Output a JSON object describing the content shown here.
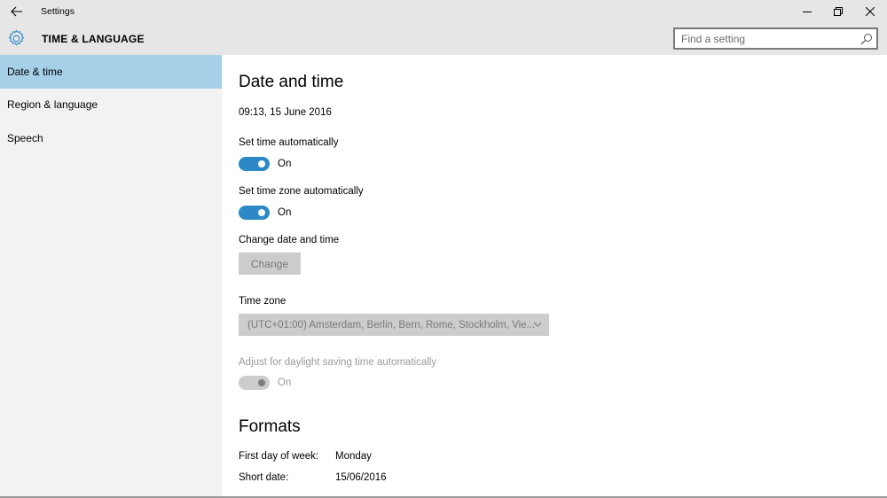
{
  "window": {
    "title": "Settings",
    "minimize_icon": "minimize-icon",
    "restore_icon": "restore-icon",
    "close_icon": "close-icon"
  },
  "header": {
    "section_title": "TIME & LANGUAGE",
    "search_placeholder": "Find a setting"
  },
  "sidebar": {
    "items": [
      {
        "label": "Date & time",
        "active": true
      },
      {
        "label": "Region & language",
        "active": false
      },
      {
        "label": "Speech",
        "active": false
      }
    ]
  },
  "main": {
    "heading": "Date and time",
    "current_datetime": "09:13, 15 June 2016",
    "set_time_auto": {
      "label": "Set time automatically",
      "state": "On"
    },
    "set_timezone_auto": {
      "label": "Set time zone automatically",
      "state": "On"
    },
    "change_date_time": {
      "label": "Change date and time",
      "button": "Change"
    },
    "time_zone": {
      "label": "Time zone",
      "value": "(UTC+01:00) Amsterdam, Berlin, Bern, Rome, Stockholm, Vie..."
    },
    "dst": {
      "label": "Adjust for daylight saving time automatically",
      "state": "On"
    },
    "formats": {
      "heading": "Formats",
      "rows": [
        {
          "label": "First day of week:",
          "value": "Monday"
        },
        {
          "label": "Short date:",
          "value": "15/06/2016"
        }
      ]
    }
  },
  "colors": {
    "accent": "#2d88c8",
    "nav_selected": "#a6cfe8",
    "titlebar": "#e6e6e6",
    "sidebar": "#f2f2f2"
  }
}
